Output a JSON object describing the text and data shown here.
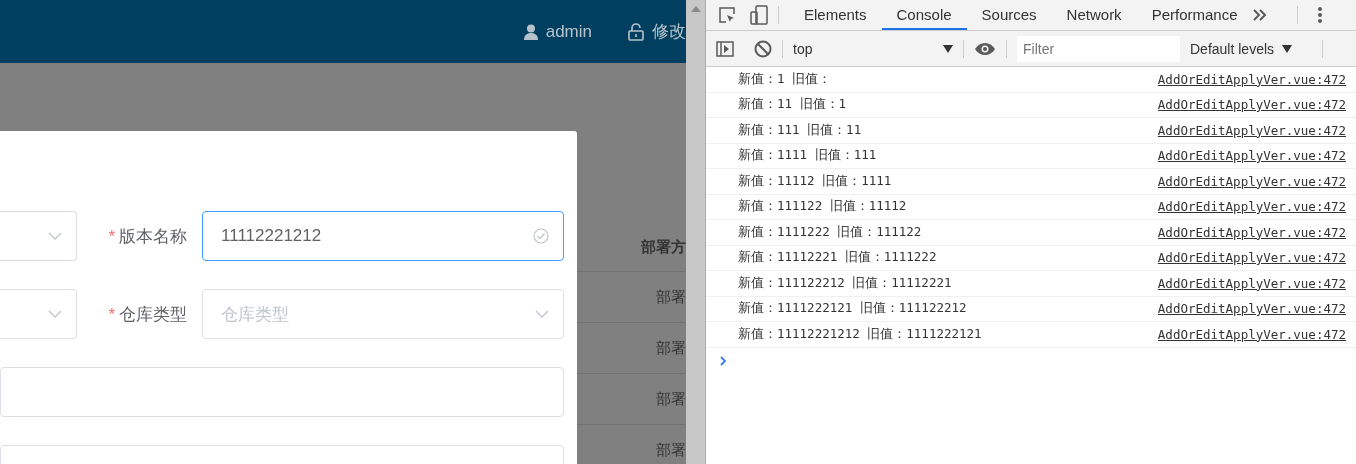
{
  "header": {
    "user": "admin",
    "change_password": "修改"
  },
  "form": {
    "rows": [
      {
        "fields": [
          {
            "kind": "select",
            "focused": false
          },
          {
            "kind": "input",
            "label": "版本名称",
            "required_mark": "*",
            "value": "11112221212",
            "focused": true
          }
        ]
      },
      {
        "fields": [
          {
            "kind": "select",
            "focused": false
          },
          {
            "kind": "select",
            "label": "仓库类型",
            "required_mark": "*",
            "placeholder": "仓库类型",
            "focused": false
          }
        ]
      },
      {
        "fields": [
          {
            "kind": "input",
            "focused": false
          }
        ]
      },
      {
        "fields": [
          {
            "kind": "input",
            "focused": false
          }
        ]
      }
    ]
  },
  "background_table": {
    "header": "部署方",
    "rows": [
      "部署",
      "部署",
      "部署",
      "部署"
    ]
  },
  "devtools": {
    "tabs": [
      {
        "label": "Elements",
        "selected": false
      },
      {
        "label": "Console",
        "selected": true
      },
      {
        "label": "Sources",
        "selected": false
      },
      {
        "label": "Network",
        "selected": false
      },
      {
        "label": "Performance",
        "selected": false
      }
    ],
    "context": "top",
    "filter_placeholder": "Filter",
    "levels": "Default levels",
    "messages": [
      {
        "text": "新值：1 旧值：",
        "source": "AddOrEditApplyVer.vue:472"
      },
      {
        "text": "新值：11 旧值：1",
        "source": "AddOrEditApplyVer.vue:472"
      },
      {
        "text": "新值：111 旧值：11",
        "source": "AddOrEditApplyVer.vue:472"
      },
      {
        "text": "新值：1111 旧值：111",
        "source": "AddOrEditApplyVer.vue:472"
      },
      {
        "text": "新值：11112 旧值：1111",
        "source": "AddOrEditApplyVer.vue:472"
      },
      {
        "text": "新值：111122 旧值：11112",
        "source": "AddOrEditApplyVer.vue:472"
      },
      {
        "text": "新值：1111222 旧值：111122",
        "source": "AddOrEditApplyVer.vue:472"
      },
      {
        "text": "新值：11112221 旧值：1111222",
        "source": "AddOrEditApplyVer.vue:472"
      },
      {
        "text": "新值：111122212 旧值：11112221",
        "source": "AddOrEditApplyVer.vue:472"
      },
      {
        "text": "新值：1111222121 旧值：111122212",
        "source": "AddOrEditApplyVer.vue:472"
      },
      {
        "text": "新值：11112221212 旧值：1111222121",
        "source": "AddOrEditApplyVer.vue:472"
      }
    ]
  }
}
